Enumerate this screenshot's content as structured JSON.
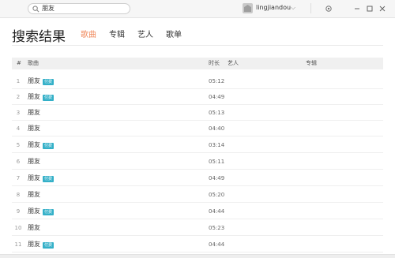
{
  "search": {
    "query": "朋友"
  },
  "user": {
    "name": "lingjiandou",
    "caret": "⌵"
  },
  "page": {
    "title": "搜索结果",
    "tabs": [
      {
        "label": "歌曲",
        "active": true
      },
      {
        "label": "专辑",
        "active": false
      },
      {
        "label": "艺人",
        "active": false
      },
      {
        "label": "歌单",
        "active": false
      }
    ]
  },
  "table": {
    "headers": {
      "num": "#",
      "song": "歌曲",
      "duration": "时长",
      "artist": "艺人",
      "album": "专辑"
    },
    "rows": [
      {
        "num": "1",
        "song": "朋友",
        "badge": "付费",
        "duration": "05:12"
      },
      {
        "num": "2",
        "song": "朋友",
        "badge": "付费",
        "duration": "04:49"
      },
      {
        "num": "3",
        "song": "朋友",
        "badge": "",
        "duration": "05:13"
      },
      {
        "num": "4",
        "song": "朋友",
        "badge": "",
        "duration": "04:40"
      },
      {
        "num": "5",
        "song": "朋友",
        "badge": "付费",
        "duration": "03:14"
      },
      {
        "num": "6",
        "song": "朋友",
        "badge": "",
        "duration": "05:11"
      },
      {
        "num": "7",
        "song": "朋友",
        "badge": "付费",
        "duration": "04:49"
      },
      {
        "num": "8",
        "song": "朋友",
        "badge": "",
        "duration": "05:20"
      },
      {
        "num": "9",
        "song": "朋友",
        "badge": "付费",
        "duration": "04:44"
      },
      {
        "num": "10",
        "song": "朋友",
        "badge": "",
        "duration": "05:23"
      },
      {
        "num": "11",
        "song": "朋友",
        "badge": "付费",
        "duration": "04:44"
      }
    ]
  },
  "colors": {
    "accent": "#f08a5d",
    "badge": "#34b0c8"
  },
  "icons": [
    "search-icon",
    "avatar-icon",
    "settings-icon",
    "minimize-icon",
    "maximize-icon",
    "close-icon"
  ]
}
